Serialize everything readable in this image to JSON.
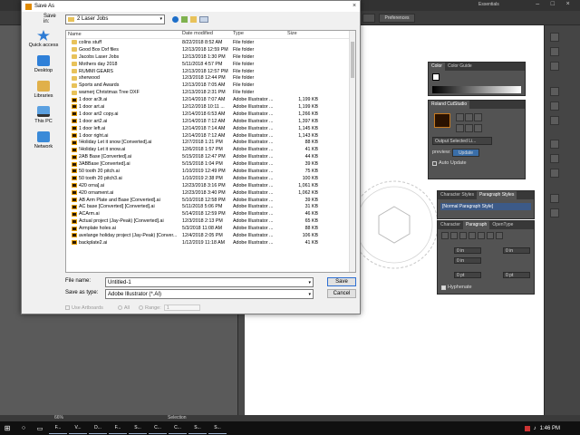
{
  "illustrator": {
    "workspace": "Essentials",
    "preferences_label": "Preferences",
    "statusbar_selection": "Selection",
    "statusbar_zoom": "66%",
    "colors": {
      "ui_dark": "#323232",
      "panel": "#535353",
      "accent_blue": "#2d6fd3"
    },
    "color_panel": {
      "tabs": [
        "Color",
        "Color Guide"
      ]
    },
    "roland_panel": {
      "title": "Roland CutStudio",
      "output_label": "Output Selected Li...",
      "preview_label": "preview:",
      "update_label": "Update",
      "auto_update_label": "Auto Update"
    },
    "styles_panel": {
      "tabs": [
        "Character Styles",
        "Paragraph Styles"
      ],
      "item": "[Normal Paragraph Style]"
    },
    "paragraph_panel": {
      "tabs": [
        "Character",
        "Paragraph",
        "OpenType"
      ],
      "indent_left": "0 in",
      "indent_right": "0 in",
      "indent_first": "0 in",
      "space_before": "0 pt",
      "space_after": "0 pt",
      "hyphenate_label": "Hyphenate"
    }
  },
  "dialog": {
    "title": "Save As",
    "save_in_label": "Save in:",
    "save_in_value": "2 Laser Jobs",
    "places": [
      {
        "label": "Quick access",
        "icon": "star-icon"
      },
      {
        "label": "Desktop",
        "icon": "desktop-icon"
      },
      {
        "label": "Libraries",
        "icon": "libraries-icon"
      },
      {
        "label": "This PC",
        "icon": "computer-icon"
      },
      {
        "label": "Network",
        "icon": "network-icon"
      }
    ],
    "columns": [
      "Name",
      "Date modified",
      "Type",
      "Size"
    ],
    "files": [
      {
        "name": "colins stuff",
        "date": "8/22/2018 8:52 AM",
        "type": "File folder",
        "size": "",
        "kind": "folder"
      },
      {
        "name": "Good Box Dxf files",
        "date": "12/13/2018 12:59 PM",
        "type": "File folder",
        "size": "",
        "kind": "folder"
      },
      {
        "name": "Jacobs Laser Jobs",
        "date": "12/13/2018 1:30 PM",
        "type": "File folder",
        "size": "",
        "kind": "folder"
      },
      {
        "name": "Mothers day 2018",
        "date": "5/11/2018 4:57 PM",
        "type": "File folder",
        "size": "",
        "kind": "folder"
      },
      {
        "name": "RUMMI GEARS",
        "date": "12/13/2018 12:57 PM",
        "type": "File folder",
        "size": "",
        "kind": "folder"
      },
      {
        "name": "sherwood",
        "date": "12/3/2018 12:44 PM",
        "type": "File folder",
        "size": "",
        "kind": "folder"
      },
      {
        "name": "Sports and Awards",
        "date": "12/13/2018 7:05 AM",
        "type": "File folder",
        "size": "",
        "kind": "folder"
      },
      {
        "name": "warnerj Christmas Tree DXF",
        "date": "12/13/2018 2:31 PM",
        "type": "File folder",
        "size": "",
        "kind": "folder"
      },
      {
        "name": "1 door ar3t.ai",
        "date": "12/14/2018 7:07 AM",
        "type": "Adobe Illustrator ...",
        "size": "1,199 KB",
        "kind": "ai"
      },
      {
        "name": "1 door art.ai",
        "date": "12/12/2018 10:11 ...",
        "type": "Adobe Illustrator ...",
        "size": "1,199 KB",
        "kind": "ai"
      },
      {
        "name": "1 door art2 copy.ai",
        "date": "12/14/2018 6:53 AM",
        "type": "Adobe Illustrator ...",
        "size": "1,266 KB",
        "kind": "ai"
      },
      {
        "name": "1 door art2.ai",
        "date": "12/14/2018 7:12 AM",
        "type": "Adobe Illustrator ...",
        "size": "1,397 KB",
        "kind": "ai"
      },
      {
        "name": "1 door left.ai",
        "date": "12/14/2018 7:14 AM",
        "type": "Adobe Illustrator ...",
        "size": "1,145 KB",
        "kind": "ai"
      },
      {
        "name": "1 door right.ai",
        "date": "12/14/2018 7:12 AM",
        "type": "Adobe Illustrator ...",
        "size": "1,143 KB",
        "kind": "ai"
      },
      {
        "name": "!Holiday Let it snow [Converted].ai",
        "date": "12/7/2018 1:21 PM",
        "type": "Adobe Illustrator ...",
        "size": "88 KB",
        "kind": "ai"
      },
      {
        "name": "!Holiday Let it snow.ai",
        "date": "12/6/2018 1:57 PM",
        "type": "Adobe Illustrator ...",
        "size": "41 KB",
        "kind": "ai"
      },
      {
        "name": "2AB Base [Converted].ai",
        "date": "5/15/2018 12:47 PM",
        "type": "Adobe Illustrator ...",
        "size": "44 KB",
        "kind": "ai"
      },
      {
        "name": "3ABBase [Converted].ai",
        "date": "5/15/2018 1:04 PM",
        "type": "Adobe Illustrator ...",
        "size": "39 KB",
        "kind": "ai"
      },
      {
        "name": "50 tooth 20 pitch.ai",
        "date": "1/10/2019 12:49 PM",
        "type": "Adobe Illustrator ...",
        "size": "75 KB",
        "kind": "ai"
      },
      {
        "name": "50 tooth 20 pitch3.ai",
        "date": "1/10/2019 2:38 PM",
        "type": "Adobe Illustrator ...",
        "size": "100 KB",
        "kind": "ai"
      },
      {
        "name": "420 orna].ai",
        "date": "12/23/2018 3:16 PM",
        "type": "Adobe Illustrator ...",
        "size": "1,061 KB",
        "kind": "ai"
      },
      {
        "name": "420 ornament.ai",
        "date": "12/23/2018 3:40 PM",
        "type": "Adobe Illustrator ...",
        "size": "1,062 KB",
        "kind": "ai"
      },
      {
        "name": "AB Arm Plate and Base [Converted].ai",
        "date": "5/10/2018 12:58 PM",
        "type": "Adobe Illustrator ...",
        "size": "39 KB",
        "kind": "ai"
      },
      {
        "name": "AC base [Converted] [Converted].ai",
        "date": "5/11/2018 5:06 PM",
        "type": "Adobe Illustrator ...",
        "size": "31 KB",
        "kind": "ai"
      },
      {
        "name": "ACArm.ai",
        "date": "5/14/2018 12:59 PM",
        "type": "Adobe Illustrator ...",
        "size": "46 KB",
        "kind": "ai"
      },
      {
        "name": "Actual project (Jay-Peak) [Converted].ai",
        "date": "12/3/2018 2:13 PM",
        "type": "Adobe Illustrator ...",
        "size": "65 KB",
        "kind": "ai"
      },
      {
        "name": "Armplate holes.ai",
        "date": "5/3/2018 11:08 AM",
        "type": "Adobe Illustrator ...",
        "size": "88 KB",
        "kind": "ai"
      },
      {
        "name": "avelange holiday project (Jay-Peak) [Conver...",
        "date": "12/4/2018 2:05 PM",
        "type": "Adobe Illustrator ...",
        "size": "106 KB",
        "kind": "ai"
      },
      {
        "name": "backplate2.ai",
        "date": "1/12/2019 11:18 AM",
        "type": "Adobe Illustrator ...",
        "size": "41 KB",
        "kind": "ai"
      }
    ],
    "file_name_label": "File name:",
    "file_name_value": "Untitled-1",
    "save_as_type_label": "Save as type:",
    "save_as_type_value": "Adobe Illustrator (*.AI)",
    "save_button": "Save",
    "cancel_button": "Cancel",
    "use_artboards_label": "Use Artboards",
    "all_label": "All",
    "range_label": "Range:",
    "range_value": "1"
  },
  "taskbar": {
    "time": "1:46 PM",
    "apps": [
      "F...",
      "V...",
      "D...",
      "F...",
      "S...",
      "C...",
      "C...",
      "S...",
      "S..."
    ]
  }
}
